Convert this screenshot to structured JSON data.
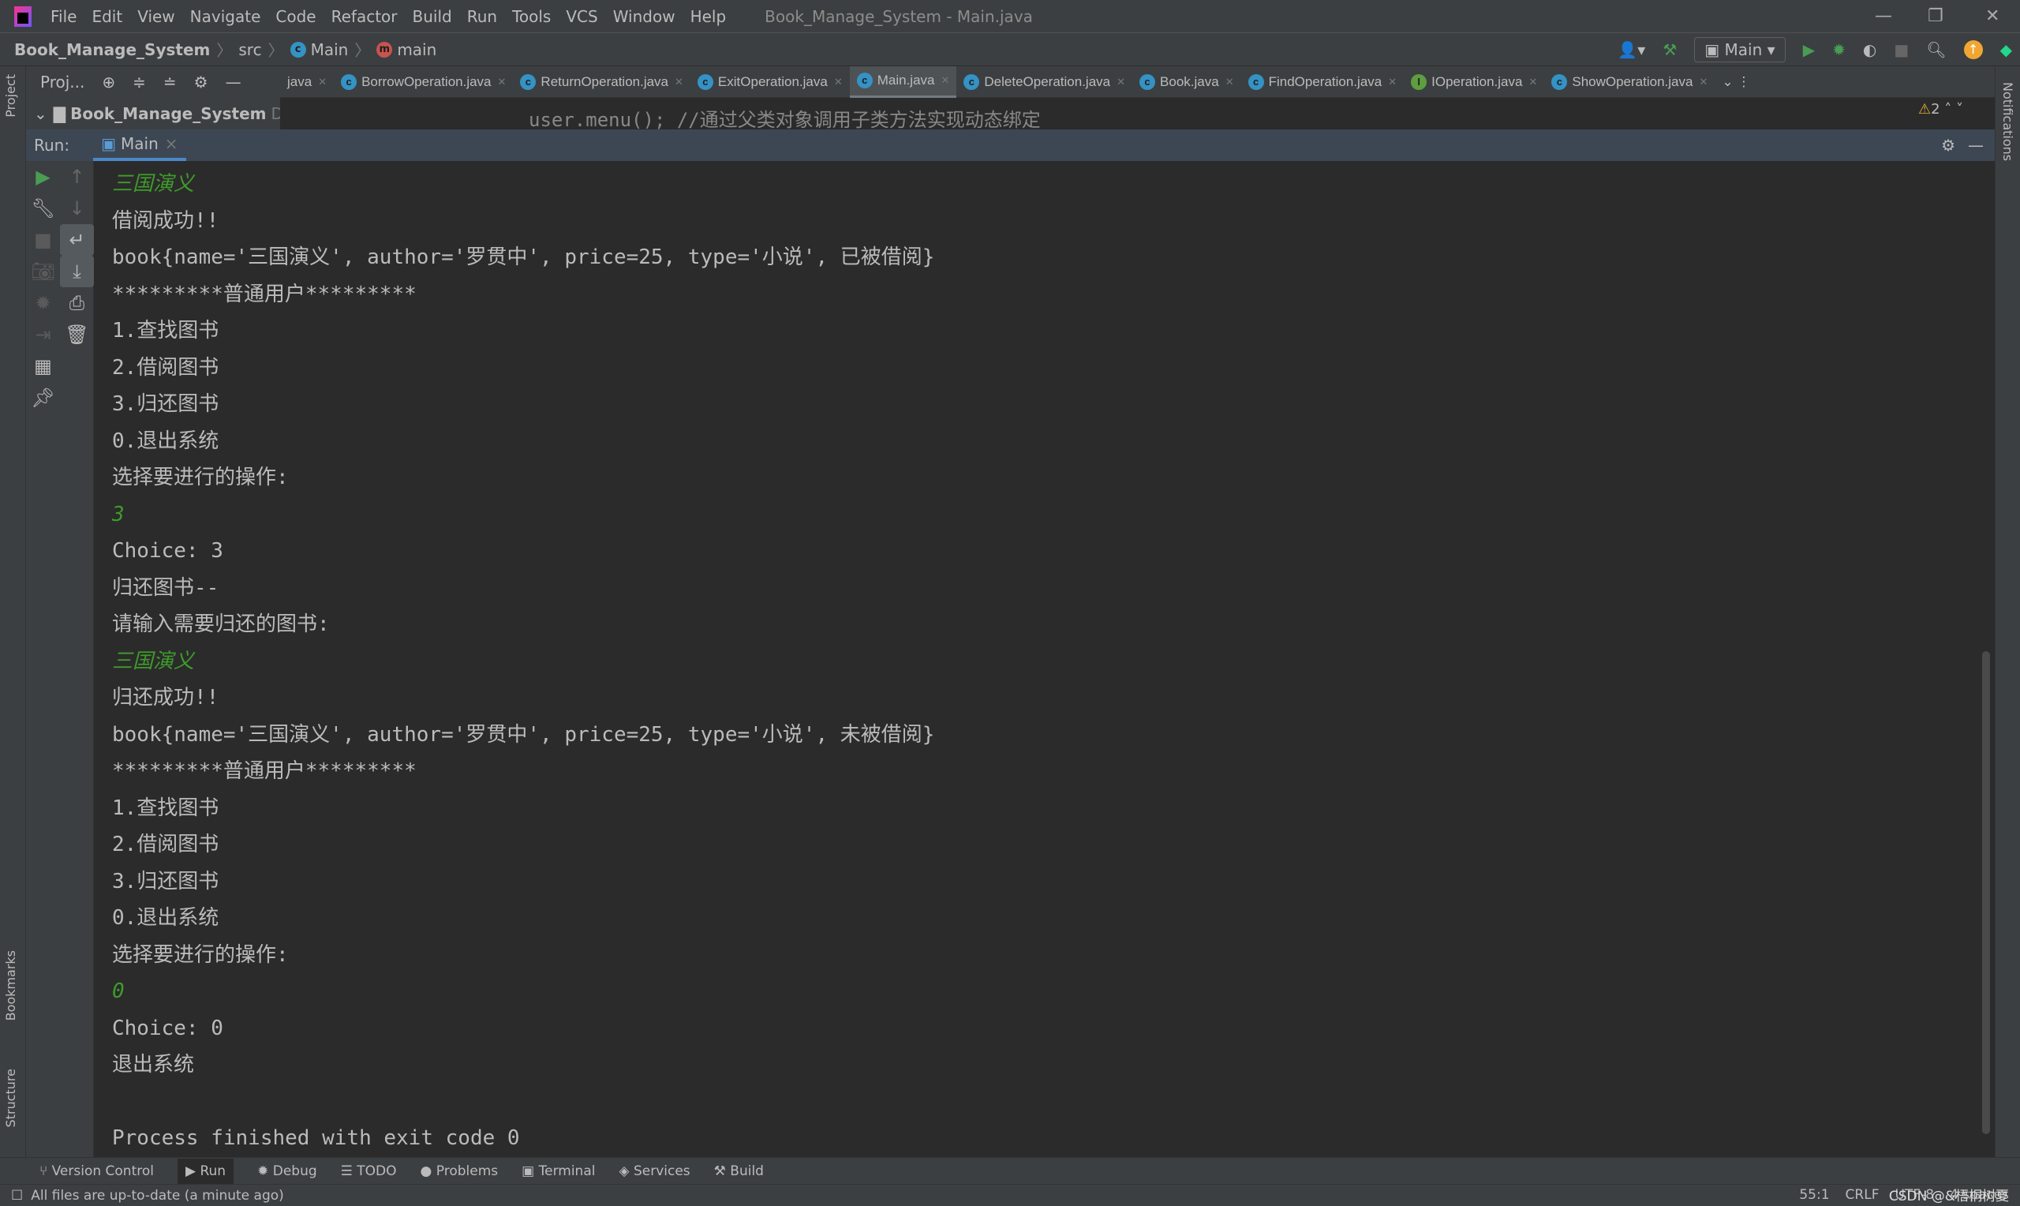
{
  "window": {
    "title": "Book_Manage_System - Main.java",
    "menu": [
      "File",
      "Edit",
      "View",
      "Navigate",
      "Code",
      "Refactor",
      "Build",
      "Run",
      "Tools",
      "VCS",
      "Window",
      "Help"
    ]
  },
  "breadcrumb": [
    "Book_Manage_System",
    "src",
    "Main",
    "main"
  ],
  "run_config": "Main",
  "project_panel": {
    "title": "Proj...",
    "root": "Book_Manage_System",
    "root_path": "D:\\Pr"
  },
  "tabs": [
    {
      "label": "java",
      "icon": "none"
    },
    {
      "label": "BorrowOperation.java",
      "icon": "class"
    },
    {
      "label": "ReturnOperation.java",
      "icon": "class"
    },
    {
      "label": "ExitOperation.java",
      "icon": "class"
    },
    {
      "label": "Main.java",
      "icon": "class",
      "active": true
    },
    {
      "label": "DeleteOperation.java",
      "icon": "class"
    },
    {
      "label": "Book.java",
      "icon": "class"
    },
    {
      "label": "FindOperation.java",
      "icon": "class"
    },
    {
      "label": "IOperation.java",
      "icon": "interface"
    },
    {
      "label": "ShowOperation.java",
      "icon": "class"
    }
  ],
  "editor": {
    "warnings": "2",
    "code_partial": "user.menu(); //通过父类对象调用子类方法实现动态绑定"
  },
  "run_panel": {
    "label": "Run:",
    "tab": "Main"
  },
  "console": [
    {
      "text": "三国演义",
      "input": true
    },
    {
      "text": "借阅成功!!"
    },
    {
      "text": "book{name='三国演义', author='罗贯中', price=25, type='小说', 已被借阅}"
    },
    {
      "text": "*********普通用户*********"
    },
    {
      "text": "1.查找图书"
    },
    {
      "text": "2.借阅图书"
    },
    {
      "text": "3.归还图书"
    },
    {
      "text": "0.退出系统"
    },
    {
      "text": "选择要进行的操作:"
    },
    {
      "text": "3",
      "input": true
    },
    {
      "text": "Choice: 3"
    },
    {
      "text": "归还图书--"
    },
    {
      "text": "请输入需要归还的图书:"
    },
    {
      "text": "三国演义",
      "input": true
    },
    {
      "text": "归还成功!!"
    },
    {
      "text": "book{name='三国演义', author='罗贯中', price=25, type='小说', 未被借阅}"
    },
    {
      "text": "*********普通用户*********"
    },
    {
      "text": "1.查找图书"
    },
    {
      "text": "2.借阅图书"
    },
    {
      "text": "3.归还图书"
    },
    {
      "text": "0.退出系统"
    },
    {
      "text": "选择要进行的操作:"
    },
    {
      "text": "0",
      "input": true
    },
    {
      "text": "Choice: 0"
    },
    {
      "text": "退出系统"
    },
    {
      "text": ""
    },
    {
      "text": "Process finished with exit code 0"
    }
  ],
  "side_labels": {
    "project": "Project",
    "bookmarks": "Bookmarks",
    "structure": "Structure",
    "notifications": "Notifications"
  },
  "bottom_tools": [
    "Version Control",
    "Run",
    "Debug",
    "TODO",
    "Problems",
    "Terminal",
    "Services",
    "Build"
  ],
  "status": {
    "message": "All files are up-to-date (a minute ago)",
    "position": "55:1",
    "line_sep": "CRLF",
    "encoding": "UTF-8",
    "indent": "4 spaces",
    "watermark": "CSDN @&梧桐树夏"
  },
  "colors": {
    "input_text": "#3e9b2b",
    "accent": "#4a88c7",
    "run_green": "#499c54"
  }
}
